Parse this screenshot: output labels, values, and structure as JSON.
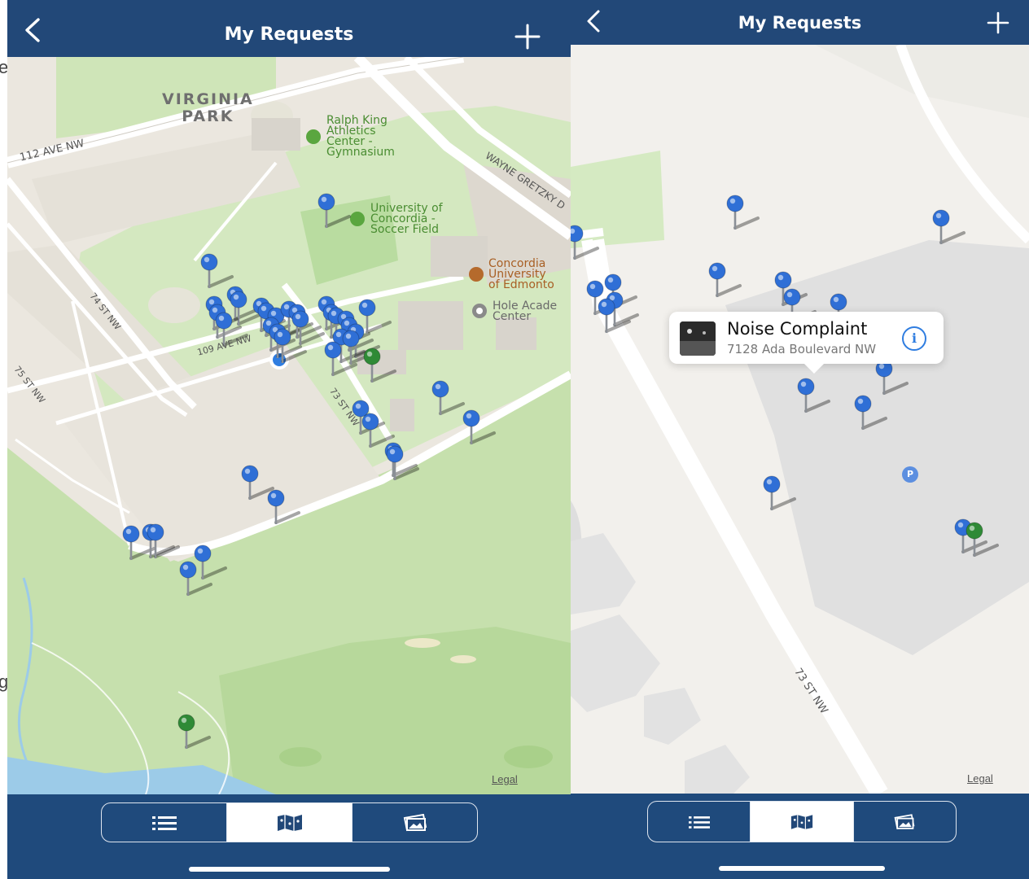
{
  "left": {
    "title": "My Requests",
    "back_glyph": "<",
    "add_glyph": "+",
    "legal": "Legal",
    "labels": {
      "park": "VIRGINIA\nPARK",
      "gym": "Ralph King\nAthletics\nCenter -\nGymnasium",
      "soccer": "University of\nConcordia -\nSoccer Field",
      "concordia": "Concordia\nUniversity\nof Edmonto",
      "hole": "Hole Acade\nCenter",
      "ave112": "112 AVE NW",
      "ave109": "109 AVE NW",
      "st74": "74 ST NW",
      "st75": "75 ST NW",
      "st73": "73 ST NW",
      "wayne": "WAYNE GRETZKY D"
    },
    "tabs": {
      "selected": "map",
      "icons": [
        "list-icon",
        "map-icon",
        "photos-icon"
      ]
    }
  },
  "right": {
    "title": "My Requests",
    "back_glyph": "<",
    "add_glyph": "+",
    "legal": "Legal",
    "street": "73 ST NW",
    "parking": "P",
    "callout": {
      "title": "Noise Complaint",
      "address": "7128 Ada Boulevard NW",
      "info_glyph": "i"
    },
    "tabs": {
      "selected": "map",
      "icons": [
        "list-icon",
        "map-icon",
        "photos-icon"
      ]
    }
  },
  "edge_letters": [
    "e",
    "g"
  ],
  "colors": {
    "navbar": "#224878",
    "pin_blue": "#2f6fd6",
    "pin_green": "#2f8a36",
    "park": "#c9e4b0",
    "road": "#ffffff"
  }
}
